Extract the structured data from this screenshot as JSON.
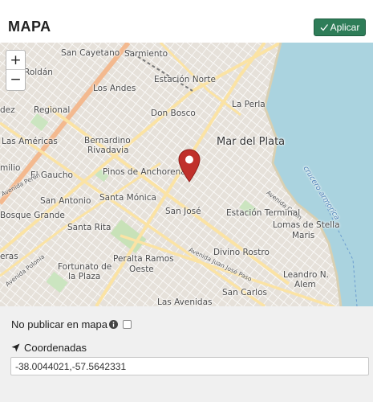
{
  "header": {
    "title": "MAPA",
    "apply_label": "Aplicar"
  },
  "map": {
    "zoom_in_label": "+",
    "zoom_out_label": "−",
    "labels": {
      "san_cayetano": "San Cayetano",
      "sarmiento": "Sarmiento",
      "roldan": "Roldán",
      "los_andes": "Los Andes",
      "estacion_norte": "Estación Norte",
      "regional": "Regional",
      "don_bosco": "Don Bosco",
      "la_perla": "La Perla",
      "dez": "dez",
      "las_americas": "Las Américas",
      "bernardino": "Bernardino",
      "rivadavia": "Rivadavia",
      "mar_del_plata": "Mar del Plata",
      "milio": "milio",
      "el_gaucho": "El Gaucho",
      "pinos": "Pinos de Anchorena",
      "crucero": "crucero armorica",
      "san_antonio": "San Antonio",
      "santa_monica": "Santa Mónica",
      "avenida_colon": "Avenida Colón",
      "bosque_grande": "Bosque Grande",
      "san_jose": "San José",
      "estacion_terminal": "Estación Terminal",
      "santa_rita": "Santa Rita",
      "lomas": "Lomas de Stella",
      "maris": "Maris",
      "eras": "eras",
      "peralta": "Peralta Ramos",
      "oeste": "Oeste",
      "divino_rostro": "Divino Rostro",
      "fortunato": "Fortunato de",
      "la_plaza": "la Plaza",
      "leandro": "Leandro N.",
      "alem": "Alem",
      "san_carlos": "San Carlos",
      "las_avenidas": "Las Avenidas",
      "avenida_peron": "Avenida Perón",
      "avenida_juan_jose_paso": "Avenida Juan José Paso",
      "avenida_polonia": "Avenida Polonia"
    }
  },
  "form": {
    "no_publish_label": "No publicar en mapa",
    "no_publish_checked": false,
    "coords_label": "Coordenadas",
    "coords_value": "-38.0044021,-57.5642331"
  },
  "colors": {
    "accent": "#2e7d58",
    "marker": "#c0302b",
    "water": "#aad3df"
  }
}
